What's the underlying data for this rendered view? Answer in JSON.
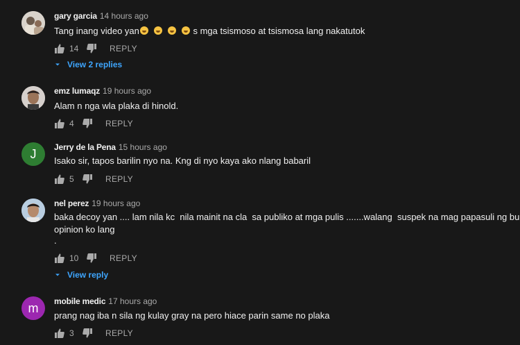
{
  "colors": {
    "background": "#181818",
    "link": "#3ea6ff",
    "secondary_text": "#aaaaaa",
    "primary_text": "#f1f1f1"
  },
  "comments": [
    {
      "author": "gary garcia",
      "time": "14 hours ago",
      "text_before_emoji": "Tang inang video yan",
      "emoji_count": 4,
      "text_after_emoji": " s mga tsismoso at tsismosa lang nakatutok",
      "likes": "14",
      "reply_label": "REPLY",
      "view_replies": "View 2 replies",
      "avatar": {
        "type": "photo",
        "icon": "avatar-photo-icon"
      }
    },
    {
      "author": "emz lumaqz",
      "time": "19 hours ago",
      "text": "Alam n nga wla plaka di hinold.",
      "likes": "4",
      "reply_label": "REPLY",
      "avatar": {
        "type": "photo",
        "icon": "avatar-photo-icon"
      }
    },
    {
      "author": "Jerry de la Pena",
      "time": "15 hours ago",
      "text": "Isako sir, tapos barilin nyo na. Kng di nyo kaya ako nlang babaril",
      "likes": "5",
      "reply_label": "REPLY",
      "avatar": {
        "type": "letter",
        "letter": "J",
        "color": "#2e7d32"
      }
    },
    {
      "author": "nel perez",
      "time": "19 hours ago",
      "text_line1": "baka decoy yan .... lam nila kc  nila mainit na cla  sa publiko at mga pulis .......walang  suspek na mag papasuli ng buhay",
      "text_line2": "opinion ko lang",
      "text_line3": ".",
      "likes": "10",
      "reply_label": "REPLY",
      "view_replies": "View reply",
      "avatar": {
        "type": "photo",
        "icon": "avatar-photo-icon"
      }
    },
    {
      "author": "mobile medic",
      "time": "17 hours ago",
      "text": "prang nag iba n sila ng kulay gray na pero hiace parin same no plaka",
      "likes": "3",
      "reply_label": "REPLY",
      "avatar": {
        "type": "letter",
        "letter": "m",
        "color": "#9c27b0"
      }
    }
  ]
}
